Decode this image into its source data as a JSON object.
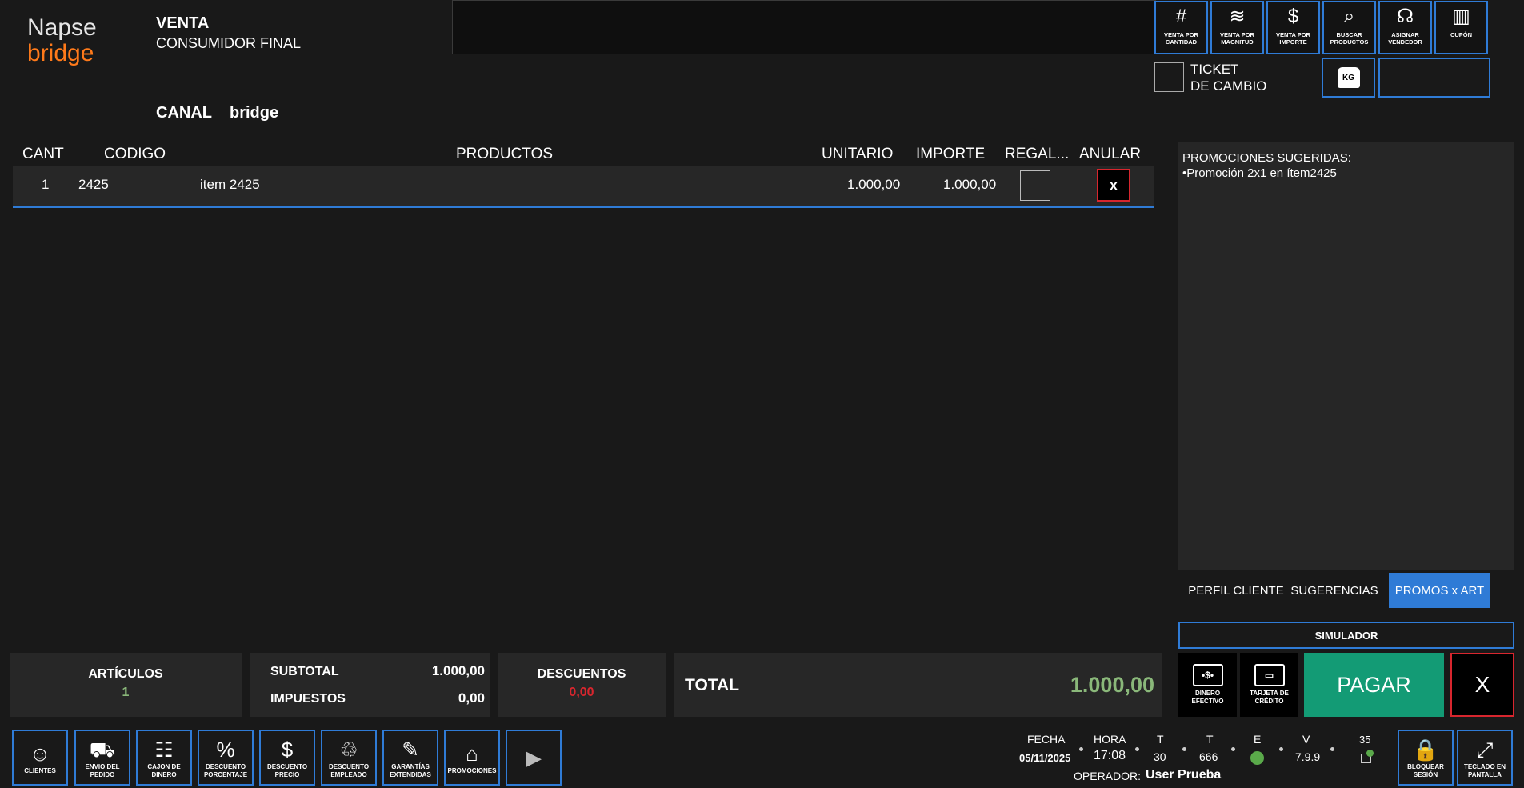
{
  "logo": {
    "line1": "Napse",
    "line2": "bridge"
  },
  "header": {
    "venta": "VENTA",
    "cliente": "CONSUMIDOR FINAL",
    "canal_label": "CANAL",
    "canal_value": "bridge"
  },
  "top_buttons": [
    {
      "icon": "#",
      "label": "VENTA POR CANTIDAD"
    },
    {
      "icon": "≋",
      "label": "VENTA POR MAGNITUD"
    },
    {
      "icon": "$",
      "label": "VENTA POR IMPORTE"
    },
    {
      "icon": "⌕",
      "label": "BUSCAR PRODUCTOS"
    },
    {
      "icon": "☊",
      "label": "ASIGNAR VENDEDOR"
    },
    {
      "icon": "▥",
      "label": "CUPÓN"
    }
  ],
  "ticket_cambio": {
    "line1": "TICKET",
    "line2": "DE CAMBIO"
  },
  "kg": "KG",
  "table": {
    "headers": {
      "cant": "CANT",
      "codigo": "CODIGO",
      "productos": "PRODUCTOS",
      "unitario": "UNITARIO",
      "importe": "IMPORTE",
      "regalo": "REGAL...",
      "anular": "ANULAR"
    },
    "rows": [
      {
        "cant": "1",
        "codigo": "2425",
        "producto": "item 2425",
        "unitario": "1.000,00",
        "importe": "1.000,00",
        "anular": "x"
      }
    ]
  },
  "promos": {
    "title": "PROMOCIONES SUGERIDAS:",
    "items": [
      "•Promoción 2x1 en ítem2425"
    ]
  },
  "tabs": [
    {
      "label": "PERFIL CLIENTE",
      "active": false
    },
    {
      "label": "SUGERENCIAS",
      "active": false
    },
    {
      "label": "PROMOS x ART",
      "active": true
    }
  ],
  "simulador": "SIMULADOR",
  "totals": {
    "articulos_label": "ARTÍCULOS",
    "articulos_value": "1",
    "subtotal_label": "SUBTOTAL",
    "subtotal_value": "1.000,00",
    "impuestos_label": "IMPUESTOS",
    "impuestos_value": "0,00",
    "descuentos_label": "DESCUENTOS",
    "descuentos_value": "0,00",
    "total_label": "TOTAL",
    "total_value": "1.000,00"
  },
  "payment": {
    "efectivo_icon": "•$•",
    "efectivo": "DINERO EFECTIVO",
    "tarjeta_icon": "▭",
    "tarjeta": "TARJETA DE CRÉDITO",
    "pagar": "PAGAR",
    "cancel": "X"
  },
  "bottom_buttons": [
    {
      "icon": "☺",
      "label": "CLIENTES"
    },
    {
      "icon": "⛟",
      "label": "ENVIO DEL PEDIDO"
    },
    {
      "icon": "☷",
      "label": "CAJON DE DINERO"
    },
    {
      "icon": "%",
      "label": "DESCUENTO PORCENTAJE"
    },
    {
      "icon": "$",
      "label": "DESCUENTO PRECIO"
    },
    {
      "icon": "♲",
      "label": "DESCUENTO EMPLEADO"
    },
    {
      "icon": "✎",
      "label": "GARANTÍAS EXTENDIDAS"
    },
    {
      "icon": "⌂",
      "label": "PROMOCIONES"
    },
    {
      "icon": "▶",
      "label": ""
    }
  ],
  "status": {
    "fecha_label": "FECHA",
    "fecha": "05/11/2025",
    "hora_label": "HORA",
    "hora": "17:08",
    "t1_label": "T",
    "t1": "30",
    "t2_label": "T",
    "t2": "666",
    "e_label": "E",
    "v_label": "V",
    "v": "7.9.9",
    "count": "35",
    "operador_label": "OPERADOR:",
    "operador": "User Prueba"
  },
  "right_buttons": [
    {
      "icon": "🔒",
      "label": "BLOQUEAR SESIÓN"
    },
    {
      "icon": "⤢",
      "label": "TECLADO EN PANTALLA"
    }
  ],
  "colors": {
    "accent": "#2f7bd6",
    "green": "#8ab87a",
    "red": "#d8262e",
    "pagar": "#139b75"
  }
}
